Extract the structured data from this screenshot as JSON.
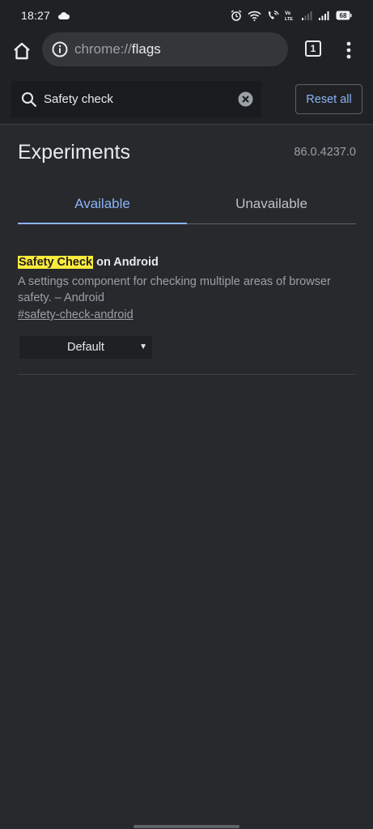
{
  "status_bar": {
    "time": "18:27",
    "battery": "68",
    "network_label": "Vo LTE"
  },
  "toolbar": {
    "url_scheme": "chrome://",
    "url_host": "flags",
    "tab_count": "1"
  },
  "search": {
    "value": "Safety check",
    "reset_label": "Reset all"
  },
  "header": {
    "title": "Experiments",
    "version": "86.0.4237.0"
  },
  "tabs": [
    {
      "label": "Available",
      "active": true
    },
    {
      "label": "Unavailable",
      "active": false
    }
  ],
  "experiments": [
    {
      "title_highlight": "Safety Check",
      "title_rest": " on Android",
      "description": "A settings component for checking multiple areas of browser safety. – Android",
      "link": "#safety-check-android",
      "selected_option": "Default"
    }
  ],
  "colors": {
    "accent": "#8ab4f8",
    "highlight": "#ffeb3b",
    "background": "#28292c",
    "toolbar": "#202124"
  }
}
